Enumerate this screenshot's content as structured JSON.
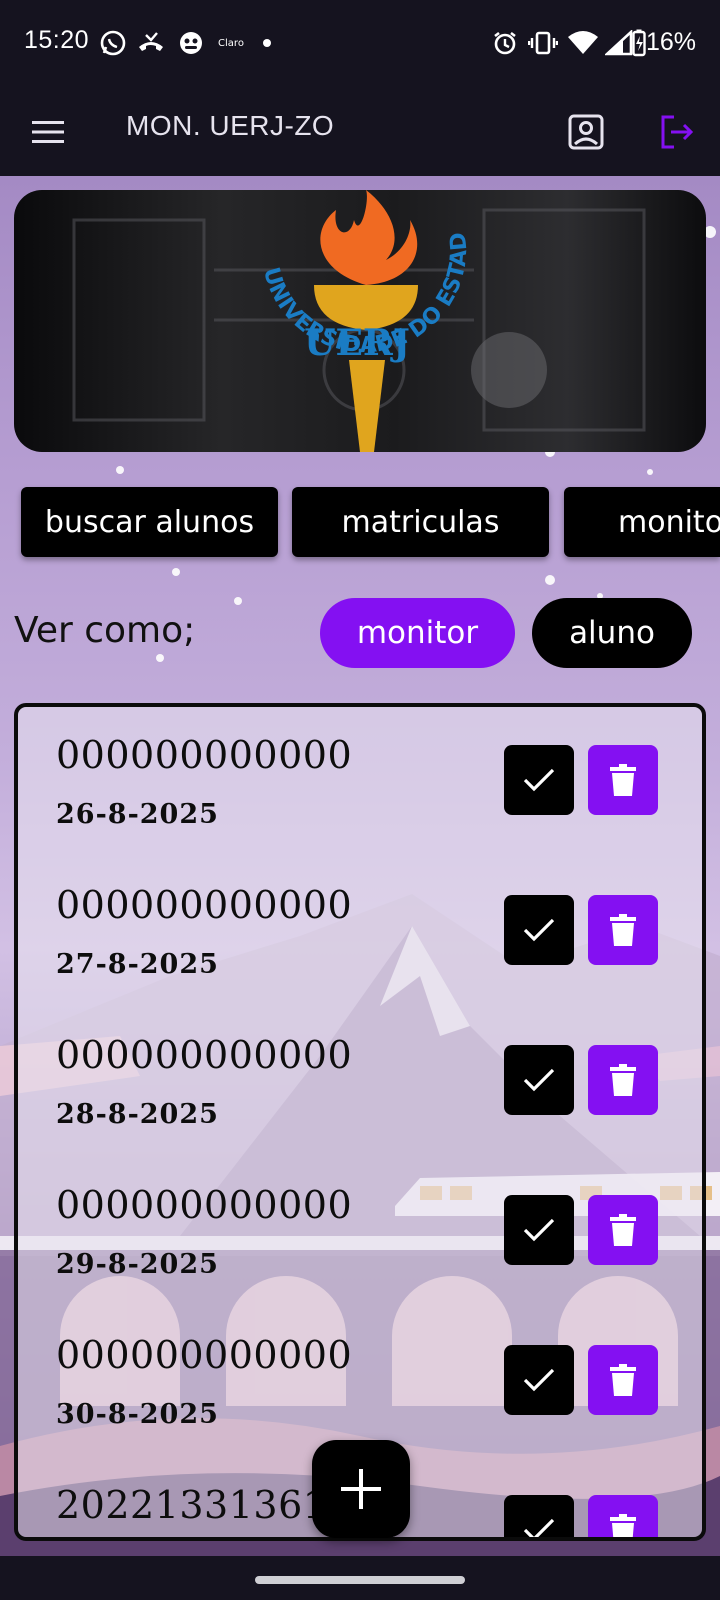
{
  "status_bar": {
    "time": "15:20",
    "notification_icons": [
      "whatsapp-icon",
      "missed-call-icon",
      "app-icon",
      "claro-icon",
      "dot-icon"
    ],
    "carrier_mini_label": "Claro",
    "system_icons": [
      "alarm-icon",
      "vibrate-icon",
      "wifi-icon",
      "signal-icon",
      "battery-charging-icon"
    ],
    "battery": "16%"
  },
  "app_bar": {
    "menu_icon": "hamburger-menu-icon",
    "title": "MON. UERJ-ZO",
    "profile_icon": "account-box-icon",
    "logout_icon": "logout-icon",
    "logout_color": "#8410f2"
  },
  "banner": {
    "logo_ring_text": "UNIVERSIDADE DO ESTADO DO RIO DE JANEIRO",
    "logo_center_text": "UERJ",
    "logo_text_color": "#1a7cc4",
    "flame_color": "#f06a22",
    "torch_color": "#e0a51e"
  },
  "tabs": [
    "buscar alunos",
    "matriculas",
    "monito"
  ],
  "view_as": {
    "label": "Ver como;",
    "options": [
      {
        "label": "monitor",
        "selected": true
      },
      {
        "label": "aluno",
        "selected": false
      }
    ]
  },
  "list": [
    {
      "id": "000000000000",
      "date": "26-8-2025"
    },
    {
      "id": "000000000000",
      "date": "27-8-2025"
    },
    {
      "id": "000000000000",
      "date": "28-8-2025"
    },
    {
      "id": "000000000000",
      "date": "29-8-2025"
    },
    {
      "id": "000000000000",
      "date": "30-8-2025"
    },
    {
      "id": "202213313610",
      "date": ""
    }
  ],
  "row_actions": {
    "confirm_icon": "check-icon",
    "delete_icon": "trash-icon"
  },
  "fab": {
    "icon": "plus-icon"
  },
  "colors": {
    "accent": "#8410f2",
    "bar_background": "#15131f"
  }
}
